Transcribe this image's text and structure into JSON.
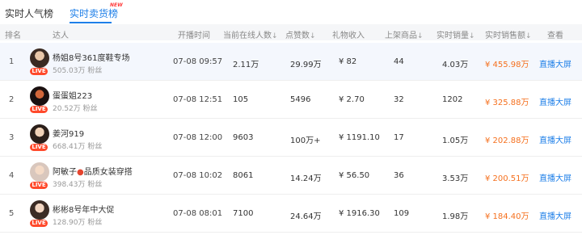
{
  "tabs": [
    {
      "label": "实时人气榜"
    },
    {
      "label": "实时卖货榜",
      "badge": "NEW"
    }
  ],
  "headers": {
    "rank": "排名",
    "anchor": "达人",
    "start_time": "开播时间",
    "online": "当前在线人数",
    "likes": "点赞数",
    "gift_income": "礼物收入",
    "products": "上架商品",
    "sales": "实时销量",
    "amount": "实时销售额",
    "watch": "查看",
    "sort_indicator": "↓"
  },
  "live_badge": "LIVE",
  "rows": [
    {
      "rank": "1",
      "name": "杨姐8号361度鞋专场",
      "fans": "505.03万 粉丝",
      "start_time": "07-08 09:57",
      "online": "2.11万",
      "likes": "29.99万",
      "gift_income": "¥ 82",
      "products": "44",
      "sales": "4.03万",
      "amount": "¥ 455.98万",
      "watch": "直播大屏"
    },
    {
      "rank": "2",
      "name": "蛋蛋姐223",
      "fans": "20.52万 粉丝",
      "start_time": "07-08 12:51",
      "online": "105",
      "likes": "5496",
      "gift_income": "¥ 2.70",
      "products": "32",
      "sales": "1202",
      "amount": "¥ 325.88万",
      "watch": "直播大屏"
    },
    {
      "rank": "3",
      "name": "姜河919",
      "fans": "668.41万 粉丝",
      "start_time": "07-08 12:00",
      "online": "9603",
      "likes": "100万+",
      "gift_income": "¥ 1191.10",
      "products": "17",
      "sales": "1.05万",
      "amount": "¥ 202.88万",
      "watch": "直播大屏"
    },
    {
      "rank": "4",
      "name": "阿敏子",
      "name_suffix": "品质女装穿搭",
      "fans": "398.43万 粉丝",
      "start_time": "07-08 10:02",
      "online": "8061",
      "likes": "14.24万",
      "gift_income": "¥ 56.50",
      "products": "36",
      "sales": "3.53万",
      "amount": "¥ 200.51万",
      "watch": "直播大屏"
    },
    {
      "rank": "5",
      "name": "彬彬8号年中大促",
      "fans": "128.90万 粉丝",
      "start_time": "07-08 08:01",
      "online": "7100",
      "likes": "24.64万",
      "gift_income": "¥ 1916.30",
      "products": "109",
      "sales": "1.98万",
      "amount": "¥ 184.40万",
      "watch": "直播大屏"
    }
  ]
}
